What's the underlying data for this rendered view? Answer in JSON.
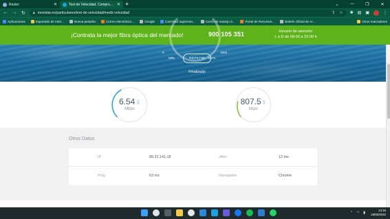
{
  "browser": {
    "tabs": [
      {
        "title": "Router",
        "active": false
      },
      {
        "title": "Test de Velocidad. Comprueba tu …",
        "active": true
      }
    ],
    "new_tab": "+",
    "url": "movistar.es/particulares/test-de-velocidad/medir-velocidad",
    "bookmarks": [
      "Aplicaciones",
      "Importado de Inter...",
      "Nueva pestaña",
      "Correo electrónico...",
      "Google",
      "Carrefour supermer...",
      "Curso de manejo d...",
      "Portal de Recursos...",
      "Boletín Oficial de Ar..."
    ],
    "bookmarks_other": "Otros marcadores"
  },
  "promo": {
    "headline": "¡Contrata la mejor fibra óptica del mercado!",
    "phone": "900 105 351",
    "hours_title": "Horario de atención",
    "hours_value": "L a D de 09:00 a 22:00 h"
  },
  "gauge": {
    "min_value": "0",
    "max_value": "1000",
    "min_label": "MIN.",
    "max_label": "MAX.",
    "repeat_button": "REPETIR",
    "status": "Finalizado"
  },
  "results": {
    "download": {
      "value": "6.54",
      "unit": "Mbps",
      "arrow": "⇩"
    },
    "upload": {
      "value": "807.5",
      "unit": "kbps",
      "arrow": "⇧"
    }
  },
  "other_data": {
    "title": "Otros Datos",
    "rows": [
      {
        "label1": "IP",
        "value1": "88.31.141.18",
        "label2": "Jitter",
        "value2": "12 ms"
      },
      {
        "label1": "Ping",
        "value1": "63 ms",
        "label2": "Navegador",
        "value2": "Chrome"
      }
    ]
  },
  "taskbar": {
    "time": "13:19",
    "date": "19/05/2022"
  },
  "colors": {
    "promo_green": "#5fb31a",
    "browser_green": "#0b5b43",
    "hero_blue": "#1a6d9f",
    "download_ring": "#2aa7e0",
    "upload_ring": "#8bc34a"
  }
}
